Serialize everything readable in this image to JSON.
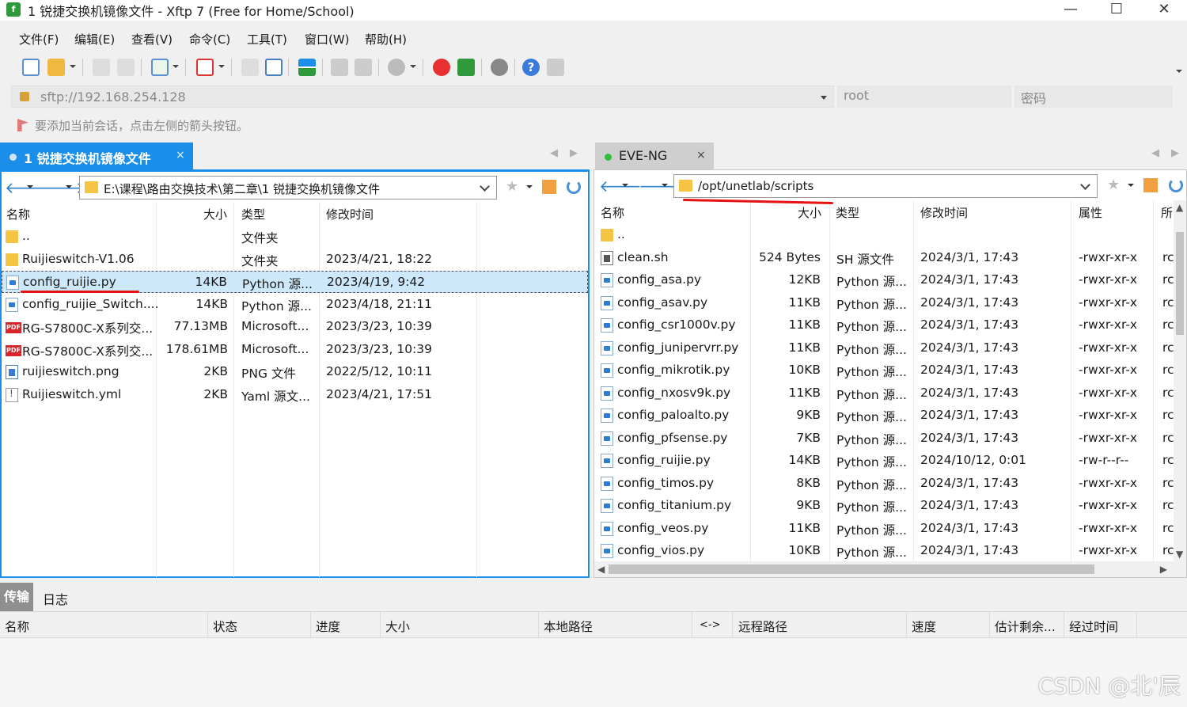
{
  "window": {
    "title": "1 锐捷交换机镜像文件 - Xftp 7 (Free for Home/School)",
    "minimize_glyph": "—",
    "maximize_glyph": "☐",
    "close_glyph": "✕"
  },
  "menu": [
    "文件(F)",
    "编辑(E)",
    "查看(V)",
    "命令(C)",
    "工具(T)",
    "窗口(W)",
    "帮助(H)"
  ],
  "address": {
    "url": "sftp://192.168.254.128",
    "user_placeholder": "root",
    "password_placeholder": "密码",
    "hint": "要添加当前会话，点击左侧的箭头按钮。"
  },
  "tabs": {
    "left": {
      "label": "1 锐捷交换机镜像文件",
      "close": "×"
    },
    "right": {
      "label": "EVE-NG",
      "close": "×"
    }
  },
  "left_pane": {
    "path": "E:\\课程\\路由交换技术\\第二章\\1 锐捷交换机镜像文件",
    "columns": [
      "名称",
      "大小",
      "类型",
      "修改时间"
    ],
    "rows": [
      {
        "icon": "folder-icon",
        "name": "..",
        "size": "",
        "type": "文件夹",
        "modified": ""
      },
      {
        "icon": "folder-icon",
        "name": "Ruijieswitch-V1.06",
        "size": "",
        "type": "文件夹",
        "modified": "2023/4/21, 18:22"
      },
      {
        "icon": "python-file-icon",
        "name": "config_ruijie.py",
        "size": "14KB",
        "type": "Python 源...",
        "modified": "2023/4/19, 9:42",
        "selected": true
      },
      {
        "icon": "python-file-icon",
        "name": "config_ruijie_Switch....",
        "size": "14KB",
        "type": "Python 源...",
        "modified": "2023/4/18, 21:11"
      },
      {
        "icon": "pdf-file-icon",
        "name": "RG-S7800C-X系列交...",
        "size": "77.13MB",
        "type": "Microsoft...",
        "modified": "2023/3/23, 10:39"
      },
      {
        "icon": "pdf-file-icon",
        "name": "RG-S7800C-X系列交...",
        "size": "178.61MB",
        "type": "Microsoft...",
        "modified": "2023/3/23, 10:39"
      },
      {
        "icon": "png-file-icon",
        "name": "ruijieswitch.png",
        "size": "2KB",
        "type": "PNG 文件",
        "modified": "2022/5/12, 10:11"
      },
      {
        "icon": "yml-file-icon",
        "name": "Ruijieswitch.yml",
        "size": "2KB",
        "type": "Yaml 源文...",
        "modified": "2023/4/21, 17:51"
      }
    ]
  },
  "right_pane": {
    "path": "/opt/unetlab/scripts",
    "columns": [
      "名称",
      "大小",
      "类型",
      "修改时间",
      "属性",
      "所"
    ],
    "rows": [
      {
        "icon": "folder-icon",
        "name": "..",
        "size": "",
        "type": "",
        "modified": "",
        "attr": "",
        "owner": ""
      },
      {
        "icon": "shell-script-icon",
        "name": "clean.sh",
        "size": "524 Bytes",
        "type": "SH 源文件",
        "modified": "2024/3/1, 17:43",
        "attr": "-rwxr-xr-x",
        "owner": "rc"
      },
      {
        "icon": "python-file-icon",
        "name": "config_asa.py",
        "size": "12KB",
        "type": "Python 源...",
        "modified": "2024/3/1, 17:43",
        "attr": "-rwxr-xr-x",
        "owner": "rc"
      },
      {
        "icon": "python-file-icon",
        "name": "config_asav.py",
        "size": "11KB",
        "type": "Python 源...",
        "modified": "2024/3/1, 17:43",
        "attr": "-rwxr-xr-x",
        "owner": "rc"
      },
      {
        "icon": "python-file-icon",
        "name": "config_csr1000v.py",
        "size": "11KB",
        "type": "Python 源...",
        "modified": "2024/3/1, 17:43",
        "attr": "-rwxr-xr-x",
        "owner": "rc"
      },
      {
        "icon": "python-file-icon",
        "name": "config_junipervrr.py",
        "size": "11KB",
        "type": "Python 源...",
        "modified": "2024/3/1, 17:43",
        "attr": "-rwxr-xr-x",
        "owner": "rc"
      },
      {
        "icon": "python-file-icon",
        "name": "config_mikrotik.py",
        "size": "10KB",
        "type": "Python 源...",
        "modified": "2024/3/1, 17:43",
        "attr": "-rwxr-xr-x",
        "owner": "rc"
      },
      {
        "icon": "python-file-icon",
        "name": "config_nxosv9k.py",
        "size": "11KB",
        "type": "Python 源...",
        "modified": "2024/3/1, 17:43",
        "attr": "-rwxr-xr-x",
        "owner": "rc"
      },
      {
        "icon": "python-file-icon",
        "name": "config_paloalto.py",
        "size": "9KB",
        "type": "Python 源...",
        "modified": "2024/3/1, 17:43",
        "attr": "-rwxr-xr-x",
        "owner": "rc"
      },
      {
        "icon": "python-file-icon",
        "name": "config_pfsense.py",
        "size": "7KB",
        "type": "Python 源...",
        "modified": "2024/3/1, 17:43",
        "attr": "-rwxr-xr-x",
        "owner": "rc"
      },
      {
        "icon": "python-file-icon",
        "name": "config_ruijie.py",
        "size": "14KB",
        "type": "Python 源...",
        "modified": "2024/10/12, 0:01",
        "attr": "-rw-r--r--",
        "owner": "rc"
      },
      {
        "icon": "python-file-icon",
        "name": "config_timos.py",
        "size": "8KB",
        "type": "Python 源...",
        "modified": "2024/3/1, 17:43",
        "attr": "-rwxr-xr-x",
        "owner": "rc"
      },
      {
        "icon": "python-file-icon",
        "name": "config_titanium.py",
        "size": "9KB",
        "type": "Python 源...",
        "modified": "2024/3/1, 17:43",
        "attr": "-rwxr-xr-x",
        "owner": "rc"
      },
      {
        "icon": "python-file-icon",
        "name": "config_veos.py",
        "size": "11KB",
        "type": "Python 源...",
        "modified": "2024/3/1, 17:43",
        "attr": "-rwxr-xr-x",
        "owner": "rc"
      },
      {
        "icon": "python-file-icon",
        "name": "config_vios.py",
        "size": "10KB",
        "type": "Python 源...",
        "modified": "2024/3/1, 17:43",
        "attr": "-rwxr-xr-x",
        "owner": "rc"
      }
    ]
  },
  "bottom": {
    "tabs": [
      "传输",
      "日志"
    ],
    "columns": [
      "名称",
      "状态",
      "进度",
      "大小",
      "本地路径",
      "<->",
      "远程路径",
      "速度",
      "估计剩余...",
      "经过时间"
    ]
  },
  "watermark": "CSDN @北'辰",
  "colors": {
    "accent": "#1a8ee8",
    "selection": "#cde8fb",
    "annotation": "#e41212"
  }
}
